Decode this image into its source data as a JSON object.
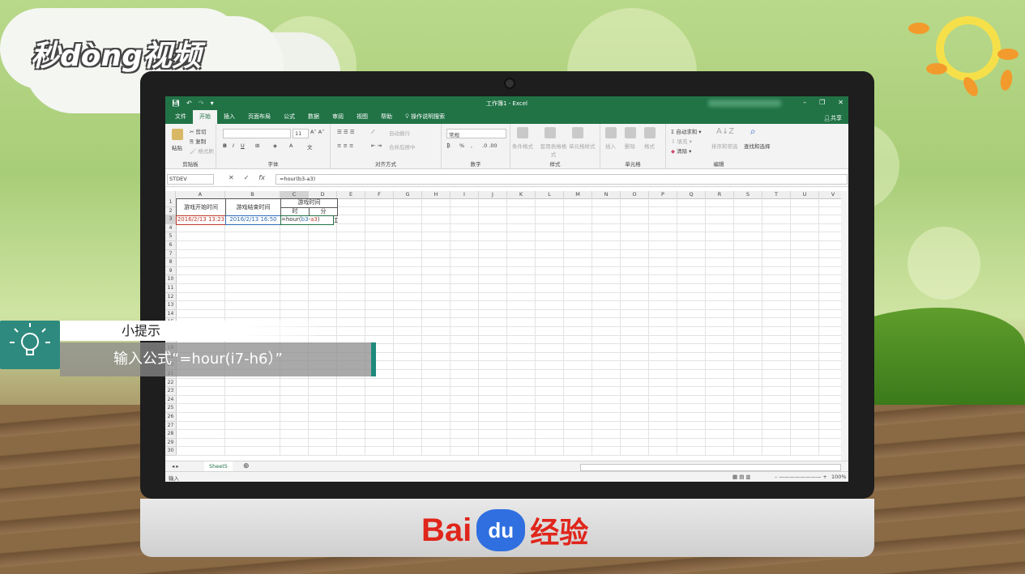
{
  "branding": {
    "top_left_logo": "秒dòng视频",
    "baidu_bai": "Bai",
    "baidu_du": "du",
    "baidu_jingyan": "经验"
  },
  "excel": {
    "window_title": "工作簿1 - Excel",
    "window_controls": [
      "–",
      "❐",
      "✕"
    ],
    "menu_tabs": [
      "文件",
      "开始",
      "插入",
      "页面布局",
      "公式",
      "数据",
      "审阅",
      "视图",
      "帮助"
    ],
    "active_tab": "开始",
    "search_label": "操作说明搜索",
    "share_label": "共享",
    "ribbon": {
      "clipboard": {
        "paste": "粘贴",
        "cut": "剪切",
        "copy": "复制",
        "format_painter": "格式刷",
        "label": "剪贴板"
      },
      "font": {
        "size": "11",
        "label": "字体"
      },
      "alignment": {
        "wrap": "自动换行",
        "merge": "合并后居中",
        "label": "对齐方式"
      },
      "number": {
        "format": "常规",
        "percent": "%",
        "label": "数字"
      },
      "styles": {
        "conditional": "条件格式",
        "table": "套用表格格式",
        "cell_styles": "单元格样式",
        "label": "样式"
      },
      "cells": {
        "insert": "插入",
        "delete": "删除",
        "format": "格式",
        "label": "单元格"
      },
      "editing": {
        "autosum": "自动求和",
        "fill": "填充",
        "clear": "清除",
        "sort": "排序和筛选",
        "find": "查找和选择",
        "label": "编辑"
      }
    },
    "name_box": "STDEV",
    "formula_bar": "=hour(b3-a3)",
    "columns": [
      "A",
      "B",
      "C",
      "D",
      "E",
      "F",
      "G",
      "H",
      "I",
      "J",
      "K",
      "L",
      "M",
      "N",
      "O",
      "P",
      "Q",
      "R",
      "S",
      "T",
      "U",
      "V"
    ],
    "rows": [
      "1",
      "2",
      "3",
      "4",
      "5",
      "6",
      "7",
      "8",
      "9",
      "10",
      "11",
      "12",
      "13",
      "14",
      "15",
      "16",
      "17",
      "18",
      "19",
      "20",
      "21",
      "22",
      "23",
      "24",
      "25",
      "26",
      "27",
      "28",
      "29",
      "30"
    ],
    "cells": {
      "A1": "游戏开始时间",
      "B1": "游戏结束时间",
      "C1": "游戏时间",
      "C2": "时",
      "D2": "分",
      "A3": "2016/2/13 13:23",
      "B3": "2016/2/13 16:50",
      "C3_prefix": "=hour(",
      "C3_ref1": "b3",
      "C3_minus": "-",
      "C3_ref2": "a3",
      "C3_suffix": ")"
    },
    "sheet_tab": "Sheet5",
    "status": "输入",
    "zoom": "100%"
  },
  "tip": {
    "title": "小提示",
    "body": "输入公式“=hour(i7-h6）”"
  },
  "colors": {
    "excel_green": "#217346",
    "tip_teal": "#2e8a7e",
    "ref_red": "#c0392b",
    "ref_blue": "#2e6db4"
  }
}
